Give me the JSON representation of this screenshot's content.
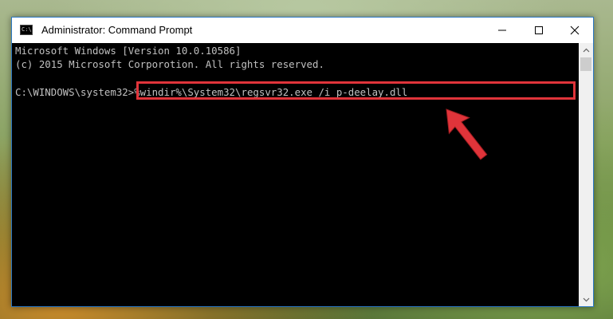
{
  "window": {
    "title": "Administrator: Command Prompt",
    "icon_glyph": "C:\\",
    "buttons": {
      "minimize": "minimize-icon",
      "maximize": "maximize-icon",
      "close": "close-icon"
    }
  },
  "console": {
    "line1": "Microsoft Windows [Version 10.0.10586]",
    "line2": "(c) 2015 Microsoft Corporotion. All rights reserved.",
    "prompt": "C:\\WINDOWS\\system32>",
    "command": "%windir%\\System32\\regsvr32.exe /i p-deelay.dll"
  },
  "annotation": {
    "highlight_color": "#e0343a",
    "arrow_color": "#e0343a"
  }
}
